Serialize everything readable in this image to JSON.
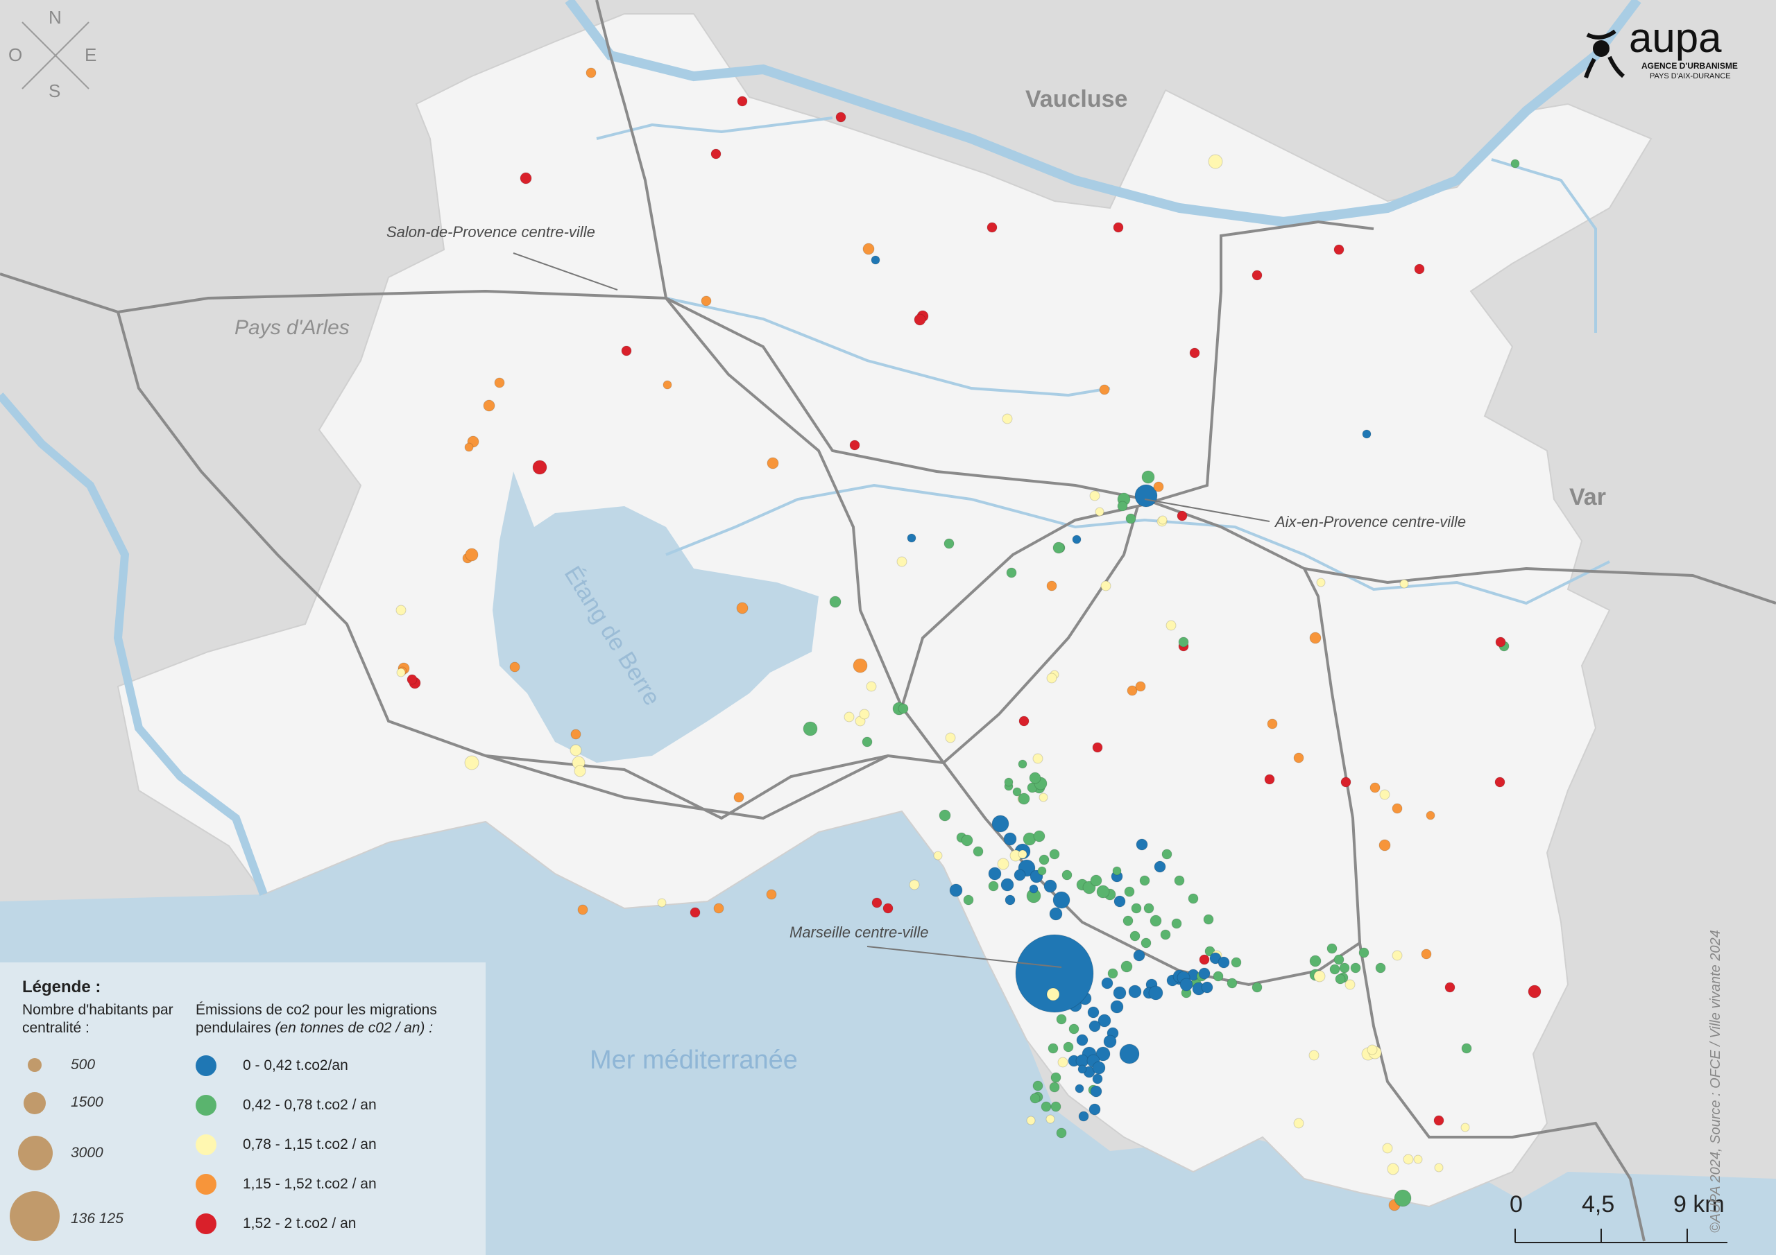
{
  "map": {
    "labels": {
      "vaucluse": "Vaucluse",
      "var": "Var",
      "pays_arles": "Pays d'Arles",
      "etang": "Étang de Berre",
      "sea": "Mer méditerranée"
    },
    "cities": {
      "salon": "Salon-de-Provence centre-ville",
      "aix": "Aix-en-Provence centre-ville",
      "marseille": "Marseille centre-ville"
    },
    "colors": {
      "land": "#f4f4f4",
      "outside": "#dcdcdc",
      "water": "#a9cde4",
      "sea": "#bfd7e6",
      "roads": "#8a8a8a",
      "class_blue": "#1f77b4",
      "class_green": "#5ab46e",
      "class_yellow": "#fff7b0",
      "class_orange": "#f7953a",
      "class_red": "#d9202a",
      "pop_symbol": "#c19a6b"
    }
  },
  "compass": {
    "n": "N",
    "s": "S",
    "e": "E",
    "o": "O"
  },
  "logo": {
    "brand": "aupa",
    "line1": "AGENCE D'URBANISME",
    "line2": "PAYS D'AIX-DURANCE"
  },
  "legend": {
    "title": "Légende :",
    "population_title": "Nombre d'habitants par centralité :",
    "population_sizes": [
      "500",
      "1500",
      "3000",
      "136 125"
    ],
    "emissions_title": "Émissions de co2 pour les migrations pendulaires",
    "emissions_unit": "(en tonnes de c02 / an) :",
    "classes": [
      {
        "label": "0 - 0,42 t.co2/an",
        "color": "#1f77b4"
      },
      {
        "label": "0,42 - 0,78 t.co2 / an",
        "color": "#5ab46e"
      },
      {
        "label": "0,78 - 1,15 t.co2 / an",
        "color": "#fff7b0"
      },
      {
        "label": "1,15 - 1,52 t.co2 / an",
        "color": "#f7953a"
      },
      {
        "label": "1,52 - 2  t.co2 / an",
        "color": "#d9202a"
      }
    ]
  },
  "scale": {
    "t0": "0",
    "t1": "4,5",
    "t2": "9 km"
  },
  "source": "©AUPA 2024,  Source : OFCE / Ville vivante 2024"
}
